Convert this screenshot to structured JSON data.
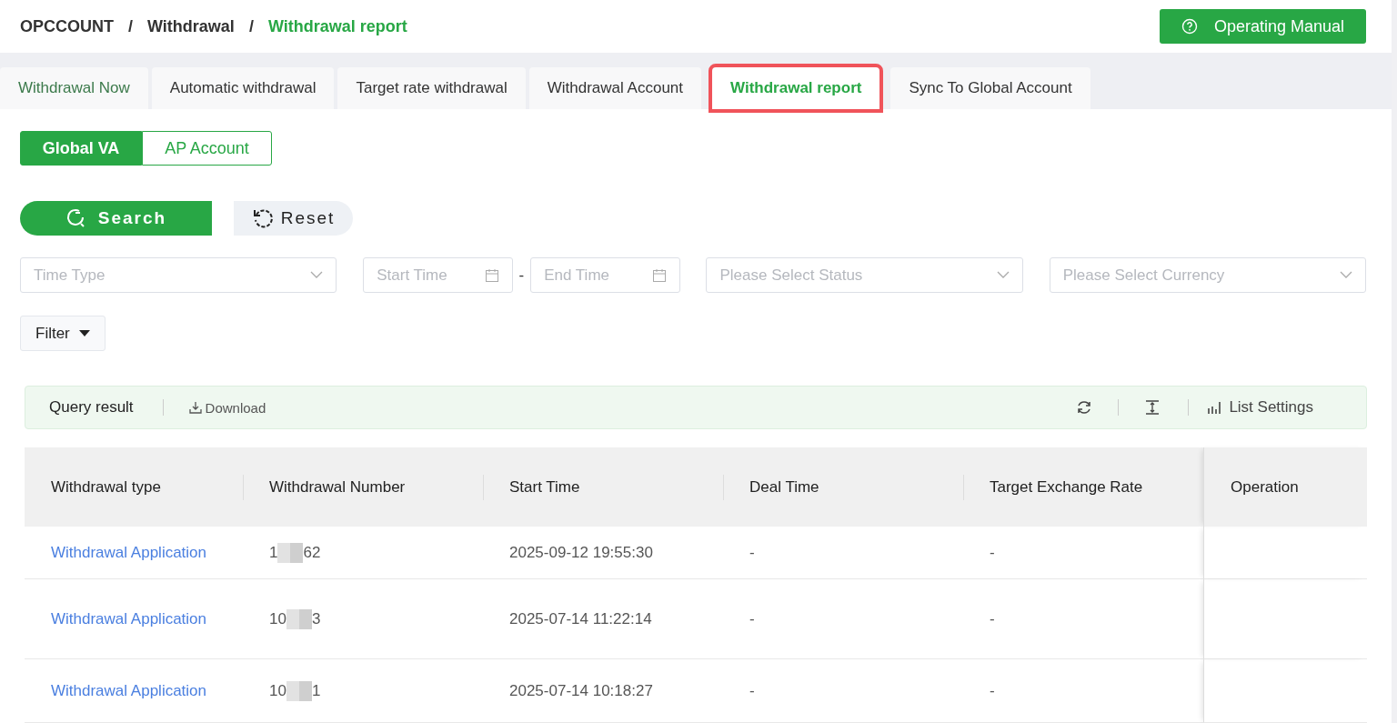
{
  "breadcrumb": [
    {
      "label": "OPCCOUNT",
      "current": false
    },
    {
      "label": "Withdrawal",
      "current": false
    },
    {
      "label": "Withdrawal report",
      "current": true
    }
  ],
  "breadcrumb_separators": [
    "/",
    "/"
  ],
  "manual_button": {
    "label": "Operating Manual"
  },
  "tabs": [
    {
      "label": "Withdrawal Now",
      "selected": false,
      "highlighted": false
    },
    {
      "label": "Automatic withdrawal",
      "selected": false,
      "highlighted": false
    },
    {
      "label": "Target rate withdrawal",
      "selected": false,
      "highlighted": false
    },
    {
      "label": "Withdrawal Account",
      "selected": false,
      "highlighted": false
    },
    {
      "label": "Withdrawal report",
      "selected": true,
      "highlighted": true
    },
    {
      "label": "Sync To Global Account",
      "selected": false,
      "highlighted": false
    }
  ],
  "account_switch": [
    {
      "label": "Global VA",
      "selected": true
    },
    {
      "label": "AP Account",
      "selected": false
    }
  ],
  "actions": {
    "search": "Search",
    "reset": "Reset"
  },
  "filters": {
    "time_type": {
      "placeholder": "Time Type"
    },
    "start_time": {
      "placeholder": "Start Time"
    },
    "range_separator": "-",
    "end_time": {
      "placeholder": "End Time"
    },
    "status": {
      "placeholder": "Please Select Status"
    },
    "currency": {
      "placeholder": "Please Select Currency"
    },
    "filter_button": "Filter"
  },
  "result_bar": {
    "title": "Query result",
    "download": "Download",
    "list_settings": "List Settings"
  },
  "table": {
    "columns": [
      "Withdrawal type",
      "Withdrawal Number",
      "Start Time",
      "Deal Time",
      "Target Exchange Rate",
      "Operation"
    ],
    "rows": [
      {
        "type": "Withdrawal Application",
        "number_start": "1",
        "number_end": "62",
        "start_time": "2025-09-12 19:55:30",
        "deal_time": "-",
        "target_rate": "-"
      },
      {
        "type": "Withdrawal Application",
        "number_start": "10",
        "number_end": "3",
        "start_time": "2025-07-14 11:22:14",
        "deal_time": "-",
        "target_rate": "-"
      },
      {
        "type": "Withdrawal Application",
        "number_start": "10",
        "number_end": "1",
        "start_time": "2025-07-14 10:18:27",
        "deal_time": "-",
        "target_rate": "-"
      }
    ]
  }
}
